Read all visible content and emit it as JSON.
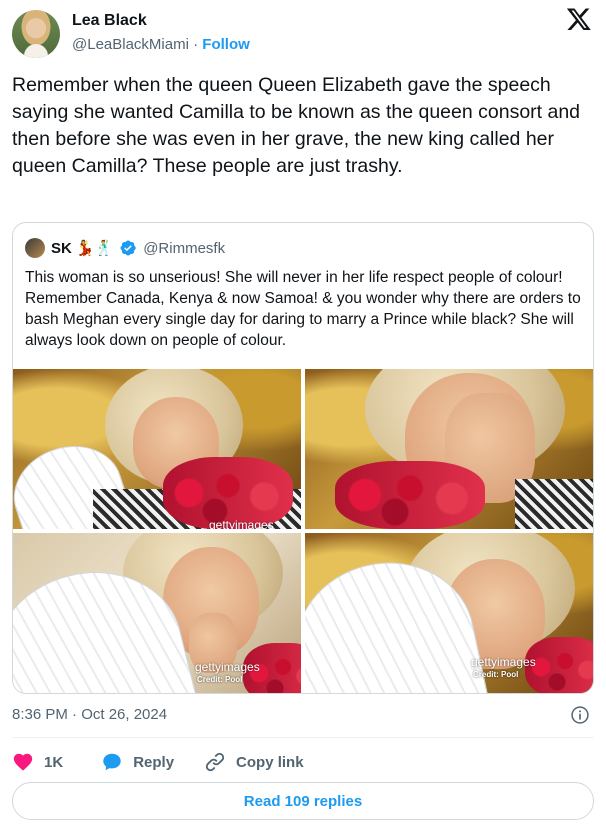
{
  "author": {
    "name": "Lea Black",
    "handle": "@LeaBlackMiami",
    "separator": "·",
    "follow_label": "Follow"
  },
  "tweet": {
    "text": "Remember when the queen Queen Elizabeth gave the speech saying she wanted Camilla to be known as the queen consort and then before she was even in her grave, the new king called her queen Camilla? These people are just trashy.",
    "timestamp": "8:36 PM · Oct 26, 2024"
  },
  "quoted_tweet": {
    "name": "SK",
    "emojis": "💃🕺",
    "handle": "@Rimmesfk",
    "text": "This woman is so unserious! She will never in her life respect people of colour! Remember Canada, Kenya & now Samoa! & you wonder why there are orders to  bash Meghan every single day for daring to marry a Prince while black? She will always look down on people of colour.",
    "photos": [
      {
        "watermark": "gettyimages",
        "credit": ""
      },
      {
        "watermark": "",
        "credit": ""
      },
      {
        "watermark": "gettyimages",
        "credit": "Credit: Pool"
      },
      {
        "watermark": "gettyimages",
        "credit": "Credit: Pool"
      }
    ]
  },
  "actions": {
    "likes_count": "1K",
    "reply_label": "Reply",
    "copy_link_label": "Copy link"
  },
  "read_replies_label": "Read 109 replies",
  "colors": {
    "accent": "#1d9bf0",
    "like": "#f91880",
    "muted": "#536471",
    "border": "#cfd9de"
  },
  "icons": [
    "x-logo-icon",
    "verified-badge-icon",
    "info-icon",
    "heart-icon",
    "reply-bubble-icon",
    "link-icon"
  ]
}
